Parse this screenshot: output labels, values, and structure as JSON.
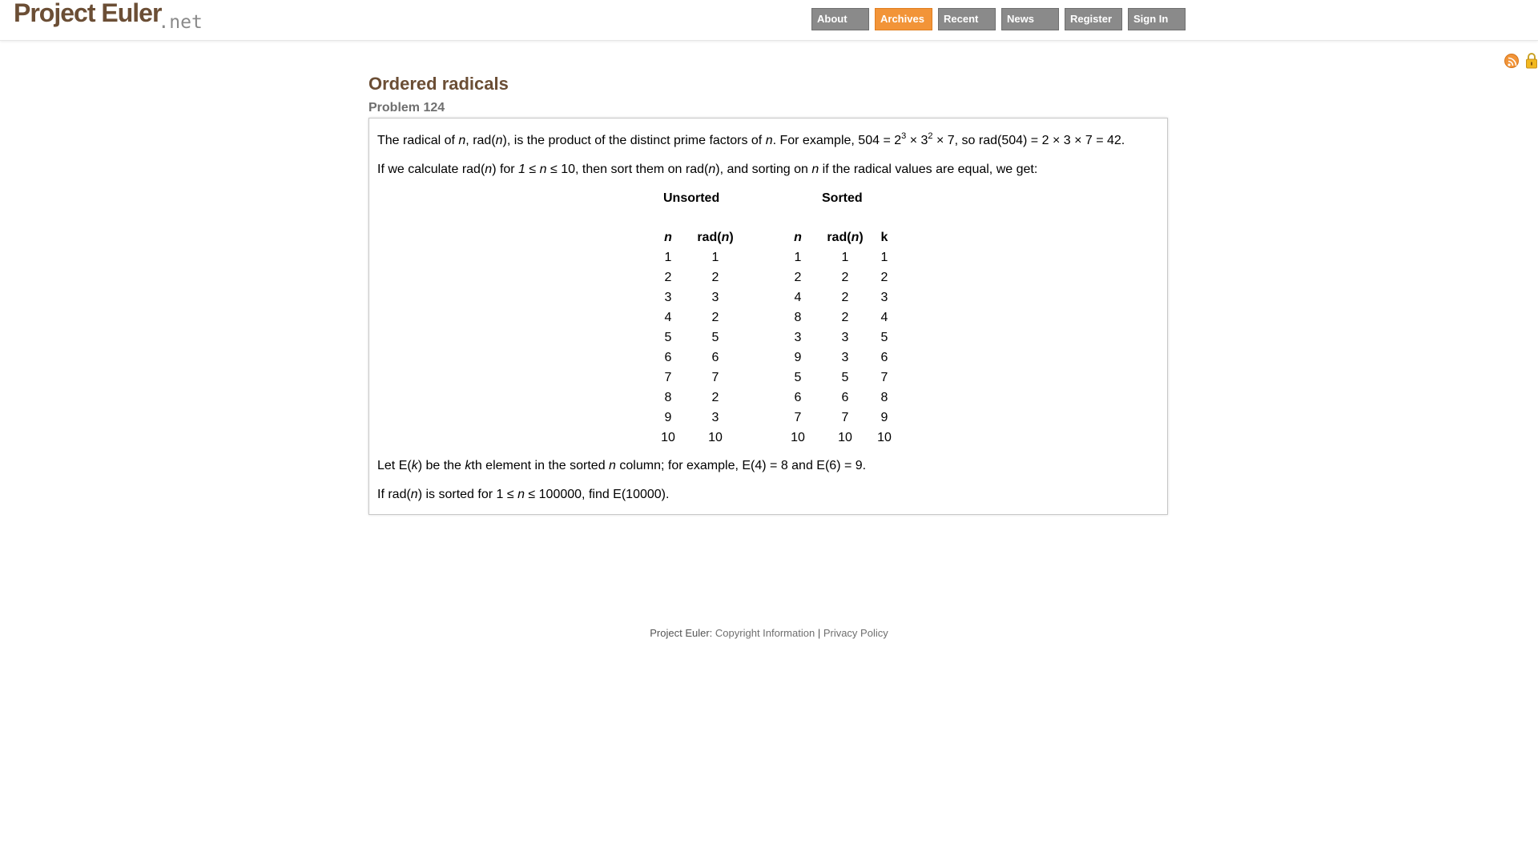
{
  "header": {
    "logo_main": "Project Euler",
    "logo_net": ".net",
    "nav": [
      {
        "label": "About",
        "active": false
      },
      {
        "label": "Archives",
        "active": true
      },
      {
        "label": "Recent",
        "active": false
      },
      {
        "label": "News",
        "active": false
      },
      {
        "label": "Register",
        "active": false
      },
      {
        "label": "Sign In",
        "active": false
      }
    ],
    "accent_color": "#f29438"
  },
  "icons": [
    "rss-icon",
    "lock-icon"
  ],
  "problem": {
    "title": "Ordered radicals",
    "number_label": "Problem 124",
    "para1": {
      "a": "The radical of ",
      "n1": "n",
      "b": ", rad(",
      "n2": "n",
      "c": "), is the product of the distinct prime factors of ",
      "n3": "n",
      "d": ". For example, 504 = 2",
      "sup1": "3",
      "e": " × 3",
      "sup2": "2",
      "f": " × 7, so rad(504) = 2 × 3 × 7 = 42."
    },
    "para2": {
      "a": "If we calculate rad(",
      "n1": "n",
      "b": ") for ",
      "i1": "1",
      "c": " ≤ ",
      "n2": "n",
      "d": " ≤ 10, then sort them on rad(",
      "n3": "n",
      "e": "), and sorting on ",
      "n4": "n",
      "f": " if the radical values are equal, we get:"
    },
    "unsorted": {
      "heading": "Unsorted",
      "col_n": "n",
      "col_rad_a": "rad(",
      "col_rad_n": "n",
      "col_rad_b": ")",
      "n": [
        "1",
        "2",
        "3",
        "4",
        "5",
        "6",
        "7",
        "8",
        "9",
        "10"
      ],
      "rad": [
        "1",
        "2",
        "3",
        "2",
        "5",
        "6",
        "7",
        "2",
        "3",
        "10"
      ]
    },
    "sorted": {
      "heading": "Sorted",
      "col_n": "n",
      "col_rad_a": "rad(",
      "col_rad_n": "n",
      "col_rad_b": ")",
      "col_k": "k",
      "n": [
        "1",
        "2",
        "4",
        "8",
        "3",
        "9",
        "5",
        "6",
        "7",
        "10"
      ],
      "rad": [
        "1",
        "2",
        "2",
        "2",
        "3",
        "3",
        "5",
        "6",
        "7",
        "10"
      ],
      "k": [
        "1",
        "2",
        "3",
        "4",
        "5",
        "6",
        "7",
        "8",
        "9",
        "10"
      ]
    },
    "para3": {
      "a": "Let E(",
      "k1": "k",
      "b": ") be the ",
      "k2": "k",
      "c": "th element in the sorted ",
      "n1": "n",
      "d": " column; for example, E(4) = 8 and E(6) = 9."
    },
    "para4": {
      "a": "If rad(",
      "n1": "n",
      "b": ") is sorted for 1 ≤ ",
      "n2": "n",
      "c": " ≤ 100000, find E(10000)."
    }
  },
  "footer": {
    "prefix": "Project Euler: ",
    "copyright": "Copyright Information",
    "sep": " | ",
    "privacy": "Privacy Policy"
  }
}
